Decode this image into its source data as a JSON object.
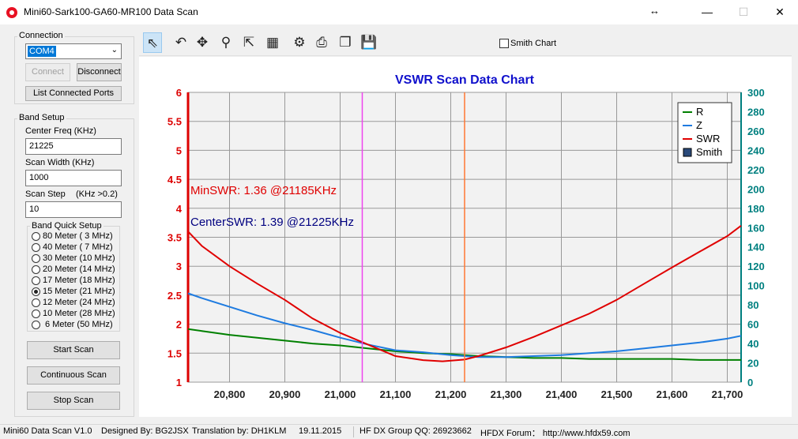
{
  "window": {
    "title": "Mini60-Sark100-GA60-MR100 Data Scan",
    "min_glyph": "—",
    "max_glyph": "☐",
    "close_glyph": "✕",
    "resize_glyph": "↔"
  },
  "connection": {
    "group_label": "Connection",
    "port_value": "COM4",
    "connect_label": "Connect",
    "disconnect_label": "Disconnect",
    "list_ports_label": "List Connected Ports"
  },
  "band_setup": {
    "group_label": "Band Setup",
    "center_freq_label": "Center Freq  (KHz)",
    "center_freq_value": "21225",
    "scan_width_label": "Scan Width   (KHz)",
    "scan_width_value": "1000",
    "scan_step_label": "Scan Step",
    "scan_step_hint": "(KHz >0.2)",
    "scan_step_value": "10"
  },
  "quick_setup": {
    "group_label": "Band Quick Setup",
    "bands": [
      {
        "label": "80 Meter  (  3 MHz)",
        "selected": false
      },
      {
        "label": "40 Meter  (  7 MHz)",
        "selected": false
      },
      {
        "label": "30 Meter  (10 MHz)",
        "selected": false
      },
      {
        "label": "20 Meter  (14 MHz)",
        "selected": false
      },
      {
        "label": "17 Meter  (18 MHz)",
        "selected": false
      },
      {
        "label": "15 Meter  (21 MHz)",
        "selected": true
      },
      {
        "label": "12 Meter  (24 MHz)",
        "selected": false
      },
      {
        "label": "10 Meter  (28 MHz)",
        "selected": false
      },
      {
        "label": " 6 Meter  (50 MHz)",
        "selected": false
      }
    ]
  },
  "actions": {
    "start_label": "Start Scan",
    "continuous_label": "Continuous Scan",
    "stop_label": "Stop Scan"
  },
  "toolbar": {
    "tools": [
      {
        "name": "pointer-icon",
        "glyph": "⇖"
      },
      {
        "name": "undo-icon",
        "glyph": "↶"
      },
      {
        "name": "pan-icon",
        "glyph": "✥"
      },
      {
        "name": "zoom-icon",
        "glyph": "⚲"
      },
      {
        "name": "export-icon",
        "glyph": "⇱"
      },
      {
        "name": "data-icon",
        "glyph": "▦"
      },
      {
        "name": "settings-icon",
        "glyph": "⚙"
      },
      {
        "name": "print-icon",
        "glyph": "⎙"
      },
      {
        "name": "copy-icon",
        "glyph": "❐"
      },
      {
        "name": "save-icon",
        "glyph": "💾"
      }
    ],
    "smith_chart_label": "Smith Chart",
    "smith_chart_checked": false
  },
  "chart_data": {
    "type": "line",
    "title": "VSWR Scan Data Chart",
    "xlabel": "",
    "ylabel": "",
    "x_ticks": [
      "20,800",
      "20,900",
      "21,000",
      "21,100",
      "21,200",
      "21,300",
      "21,400",
      "21,500",
      "21,600",
      "21,700"
    ],
    "xlim": [
      20725,
      21725
    ],
    "left_axis": {
      "ylim": [
        1,
        6
      ],
      "ticks": [
        "1",
        "1.5",
        "2",
        "2.5",
        "3",
        "3.5",
        "4",
        "4.5",
        "5",
        "5.5",
        "6"
      ],
      "color": "#dd0000"
    },
    "right_axis": {
      "ylim": [
        0,
        300
      ],
      "ticks": [
        "0",
        "20",
        "40",
        "60",
        "80",
        "100",
        "120",
        "140",
        "160",
        "180",
        "200",
        "220",
        "240",
        "260",
        "280",
        "300"
      ],
      "color": "#008080"
    },
    "grid": true,
    "legend_position": "top-right",
    "series": [
      {
        "name": "R",
        "axis": "right",
        "color": "#008000",
        "x": [
          20725,
          20750,
          20800,
          20850,
          20900,
          20950,
          21000,
          21050,
          21100,
          21150,
          21200,
          21250,
          21300,
          21350,
          21400,
          21450,
          21500,
          21550,
          21600,
          21650,
          21700,
          21725
        ],
        "y": [
          55,
          53,
          49,
          46,
          43,
          40,
          38,
          35,
          32,
          30,
          29,
          27,
          26,
          25,
          25,
          24,
          24,
          24,
          24,
          23,
          23,
          23
        ]
      },
      {
        "name": "Z",
        "axis": "right",
        "color": "#1e7be0",
        "x": [
          20725,
          20750,
          20800,
          20850,
          20900,
          20950,
          21000,
          21050,
          21100,
          21150,
          21200,
          21250,
          21300,
          21350,
          21400,
          21450,
          21500,
          21550,
          21600,
          21650,
          21700,
          21725
        ],
        "y": [
          92,
          87,
          78,
          69,
          61,
          54,
          46,
          39,
          33,
          31,
          28,
          26,
          26,
          27,
          28,
          30,
          32,
          35,
          38,
          41,
          45,
          48
        ]
      },
      {
        "name": "SWR",
        "axis": "left",
        "color": "#e00000",
        "x": [
          20725,
          20750,
          20800,
          20850,
          20900,
          20950,
          21000,
          21050,
          21100,
          21150,
          21185,
          21225,
          21250,
          21300,
          21350,
          21400,
          21450,
          21500,
          21550,
          21600,
          21650,
          21700,
          21725
        ],
        "y": [
          3.6,
          3.35,
          3.0,
          2.7,
          2.42,
          2.1,
          1.85,
          1.65,
          1.45,
          1.38,
          1.36,
          1.39,
          1.45,
          1.6,
          1.78,
          1.98,
          2.18,
          2.42,
          2.7,
          2.98,
          3.25,
          3.52,
          3.7
        ]
      }
    ],
    "legend": [
      "R",
      "Z",
      "SWR",
      "Smith"
    ],
    "markers": [
      {
        "x": 21040,
        "color": "#ee44ee"
      },
      {
        "x": 21225,
        "color": "#ff7733"
      }
    ],
    "annotations": [
      {
        "text": "MinSWR: 1.36 @21185KHz",
        "color": "#e00000"
      },
      {
        "text": "CenterSWR: 1.39 @21225KHz",
        "color": "#000080"
      }
    ]
  },
  "status": {
    "version": "Mini60 Data Scan V1.0",
    "designer": "Designed By: BG2JSX",
    "translator": "Translation by: DH1KLM",
    "date": "19.11.2015",
    "group": "HF DX Group QQ: 26923662",
    "forum": "HFDX Forum： http://www.hfdx59.com"
  }
}
